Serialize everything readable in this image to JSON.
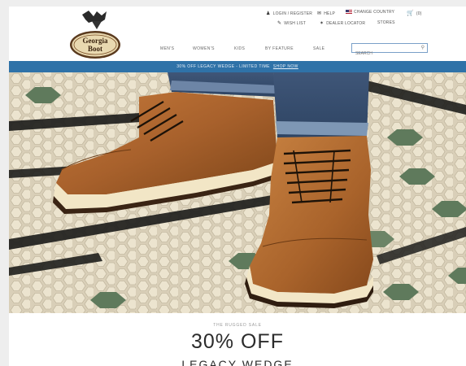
{
  "brand": {
    "logo_text_line1": "Georgia",
    "logo_text_line2": "Boot"
  },
  "utility": {
    "account": "LOGIN / REGISTER",
    "help": "HELP",
    "country": "CHANGE COUNTRY",
    "cart_count": "(0)",
    "wishlist": "WISH LIST",
    "dealer": "DEALER LOCATOR",
    "stores": "STORES"
  },
  "nav": {
    "items": [
      "MEN'S",
      "WOMEN'S",
      "KIDS",
      "BY FEATURE",
      "SALE"
    ]
  },
  "search": {
    "placeholder": "SEARCH"
  },
  "promo": {
    "text": "30% OFF LEGACY WEDGE - LIMITED TIME",
    "link": "SHOP NOW"
  },
  "hero_copy": {
    "kicker": "THE RUGGED SALE",
    "headline": "30% OFF",
    "subheadline": "LEGACY WEDGE"
  },
  "colors": {
    "promo_bar": "#2f72a8",
    "search_border": "#7aa0c8",
    "boot_leather": "#a8612c"
  }
}
